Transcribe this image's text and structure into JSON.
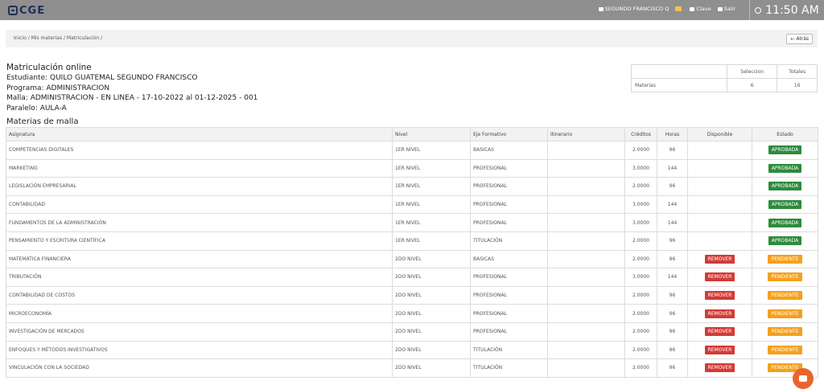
{
  "header": {
    "logo_text": "CGE",
    "user_name": "SEGUNDO FRANCISCO Q",
    "clave_label": "Clave",
    "salir_label": "Salir",
    "time": "11:50 AM"
  },
  "breadcrumb": {
    "text": "Inicio / Mis materias / Matriculación /",
    "back_label": "← Atrás"
  },
  "info": {
    "title": "Matriculación online",
    "student": "Estudiante: QUILO GUATEMAL SEGUNDO FRANCISCO",
    "program": "Programa: ADMINISTRACION",
    "malla": "Malla: ADMINISTRACION - EN LINEA - 17-10-2022 al 01-12-2025 - 001",
    "paralelo": "Paralelo: AULA-A"
  },
  "summary": {
    "col1": "Seleccion",
    "col2": "Totales",
    "row_label": "Materias",
    "selected": "6",
    "total": "16"
  },
  "section_title": "Materias de malla",
  "columns": [
    "Asignatura",
    "Nivel",
    "Eje Formativo",
    "Itinerario",
    "Créditos",
    "Horas",
    "Disponible",
    "Estado"
  ],
  "rows": [
    [
      "COMPETENCIAS DIGITALES",
      "1ER NIVEL",
      "BASICAS",
      "",
      "2.0000",
      "96",
      "",
      "APROBADA"
    ],
    [
      "MARKETING",
      "1ER NIVEL",
      "PROFESIONAL",
      "",
      "3.0000",
      "144",
      "",
      "APROBADA"
    ],
    [
      "LEGISLACIÓN EMPRESARIAL",
      "1ER NIVEL",
      "PROFESIONAL",
      "",
      "2.0000",
      "96",
      "",
      "APROBADA"
    ],
    [
      "CONTABILIDAD",
      "1ER NIVEL",
      "PROFESIONAL",
      "",
      "3.0000",
      "144",
      "",
      "APROBADA"
    ],
    [
      "FUNDAMENTOS DE LA ADMINISTRACIÓN",
      "1ER NIVEL",
      "PROFESIONAL",
      "",
      "3.0000",
      "144",
      "",
      "APROBADA"
    ],
    [
      "PENSAMIENTO Y ESCRITURA CIENTÍFICA",
      "1ER NIVEL",
      "TITULACIÓN",
      "",
      "2.0000",
      "96",
      "",
      "APROBADA"
    ],
    [
      "MATEMÁTICA FINANCIERA",
      "2DO NIVEL",
      "BASICAS",
      "",
      "2.0000",
      "96",
      "REMOVER",
      "PENDIENTE"
    ],
    [
      "TRIBUTACIÓN",
      "2DO NIVEL",
      "PROFESIONAL",
      "",
      "3.0000",
      "144",
      "REMOVER",
      "PENDIENTE"
    ],
    [
      "CONTABILIDAD DE COSTOS",
      "2DO NIVEL",
      "PROFESIONAL",
      "",
      "2.0000",
      "96",
      "REMOVER",
      "PENDIENTE"
    ],
    [
      "MICROECONOMÍA",
      "2DO NIVEL",
      "PROFESIONAL",
      "",
      "2.0000",
      "96",
      "REMOVER",
      "PENDIENTE"
    ],
    [
      "INVESTIGACIÓN DE MERCADOS",
      "2DO NIVEL",
      "PROFESIONAL",
      "",
      "2.0000",
      "96",
      "REMOVER",
      "PENDIENTE"
    ],
    [
      "ENFOQUES Y MÉTODOS INVESTIGATIVOS",
      "2DO NIVEL",
      "TITULACIÓN",
      "",
      "2.0000",
      "96",
      "REMOVER",
      "PENDIENTE"
    ],
    [
      "VINCULACIÓN CON LA SOCIEDAD",
      "2DO NIVEL",
      "TITULACIÓN",
      "",
      "2.0000",
      "96",
      "REMOVER",
      "PENDIENTE"
    ]
  ],
  "colors": {
    "approved": "#2e8b3c",
    "pending": "#f5a01b",
    "remove": "#d43a36",
    "topbar": "#8f8f8f"
  }
}
